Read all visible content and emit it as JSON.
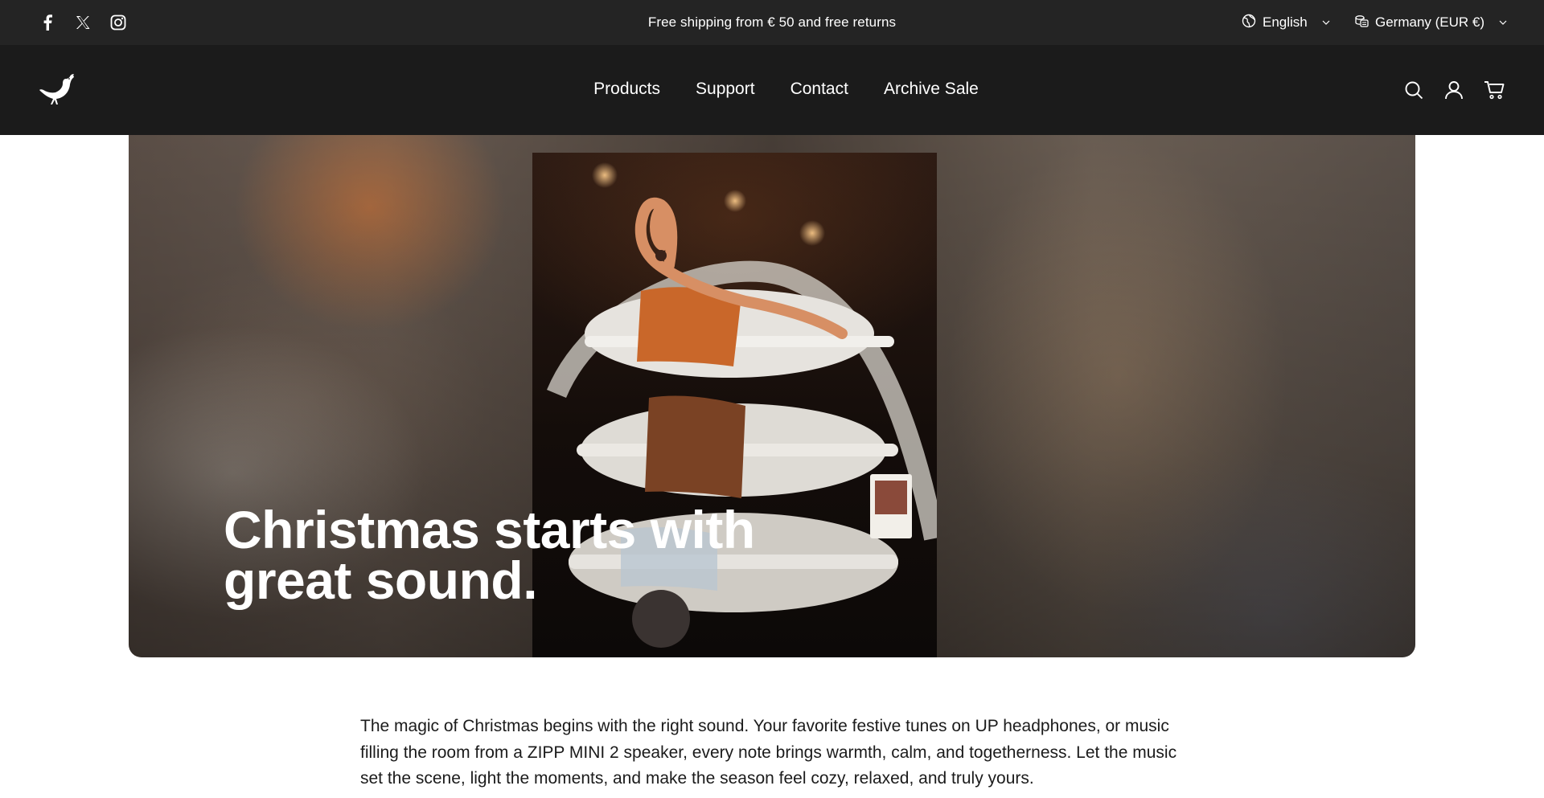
{
  "announcement": {
    "text": "Free shipping from € 50 and free returns"
  },
  "social": [
    "facebook-icon",
    "x-icon",
    "instagram-icon"
  ],
  "locale": {
    "language": "English",
    "country": "Germany (EUR €)"
  },
  "nav": {
    "items": [
      "Products",
      "Support",
      "Contact",
      "Archive Sale"
    ]
  },
  "header_icons": [
    "search-icon",
    "account-icon",
    "cart-icon"
  ],
  "hero": {
    "title": "Christmas starts with great sound."
  },
  "intro": {
    "text": "The magic of Christmas begins with the right sound. Your favorite festive tunes on UP headphones, or music filling the room from a ZIPP MINI 2 speaker, every note brings warmth, calm, and togetherness. Let the music set the scene, light the moments, and make the season feel cozy, relaxed, and truly yours."
  },
  "colors": {
    "topbar": "#242424",
    "header": "#1b1b1b",
    "text": "#1b1b1b",
    "on_dark": "#ffffff"
  }
}
